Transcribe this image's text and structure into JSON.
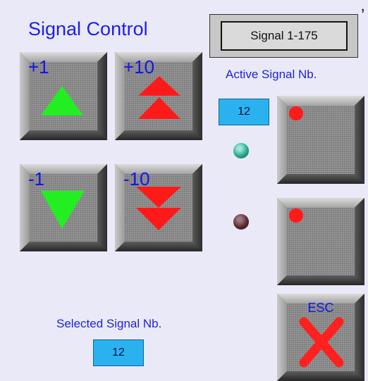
{
  "title": "Signal Control",
  "signal_range_label": "Signal 1-175",
  "active_signal": {
    "caption": "Active Signal Nb.",
    "value": "12"
  },
  "selected_signal": {
    "caption": "Selected Signal Nb.",
    "value": "12"
  },
  "buttons": {
    "plus1": "+1",
    "plus10": "+10",
    "minus1": "-1",
    "minus10": "-10",
    "esc": "ESC"
  },
  "indicators": {
    "lamp_upper": {
      "state": "green"
    },
    "lamp_lower": {
      "state": "off-red"
    }
  },
  "colors": {
    "title": "#1d1df0",
    "up_arrow": "#22ee22",
    "down_arrow": "#22ee22",
    "double_arrow": "#ff1a1a",
    "status_dot": "#ff1a1a",
    "esc_cross": "#ff2020",
    "number_box": "#2ab2f0"
  }
}
